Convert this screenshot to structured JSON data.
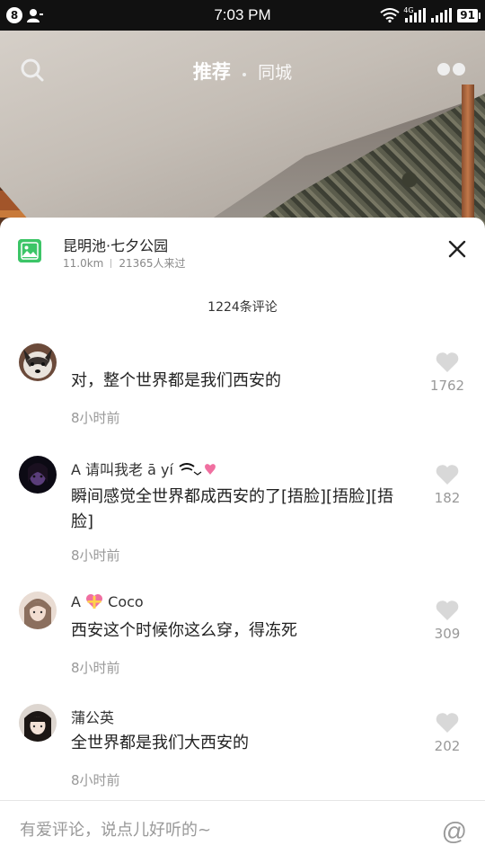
{
  "status_bar": {
    "notification_count": "8",
    "time": "7:03 PM",
    "signal_badge": "4G",
    "battery": "91"
  },
  "top_nav": {
    "active_tab": "推荐",
    "tab_2": "同城",
    "search_icon": "search-icon",
    "more_icon": "dots-icon"
  },
  "location": {
    "name": "昆明池·七夕公园",
    "distance": "11.0km",
    "visitors": "21365人来过",
    "icon": "image-icon"
  },
  "comments_header": {
    "count_label": "1224条评论"
  },
  "comments": [
    {
      "username": "",
      "text": "对，整个世界都是我们西安的",
      "time": "8小时前",
      "likes": "1762"
    },
    {
      "username": "A 请叫我老 ā yí",
      "text": "瞬间感觉全世界都成西安的了[捂脸][捂脸][捂脸]",
      "time": "8小时前",
      "likes": "182"
    },
    {
      "username": "A",
      "username_suffix": "Coco",
      "text": "西安这个时候你这么穿，得冻死",
      "time": "8小时前",
      "likes": "309"
    },
    {
      "username": "蒲公英",
      "text": "全世界都是我们大西安的",
      "time": "8小时前",
      "likes": "202"
    }
  ],
  "input": {
    "placeholder": "有爱评论，说点儿好听的~",
    "at_label": "@"
  },
  "colors": {
    "poi_green": "#3cc567",
    "muted_text": "#999999",
    "heart_gray": "#d8d8d8"
  }
}
